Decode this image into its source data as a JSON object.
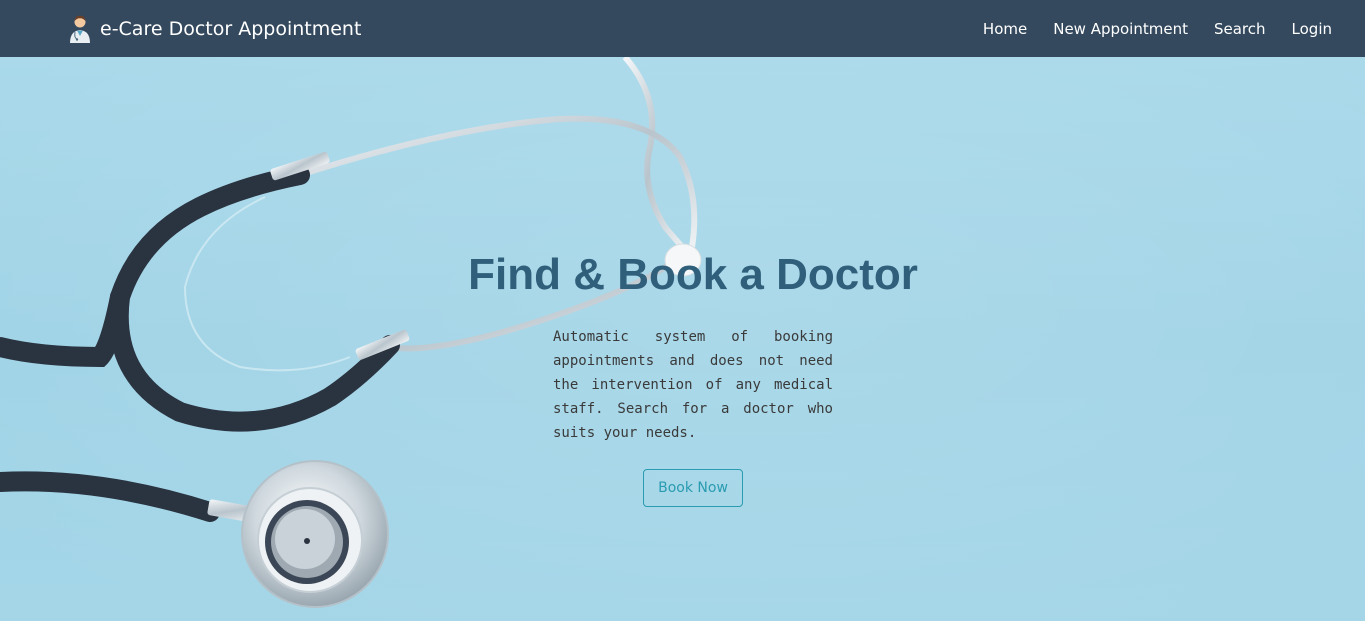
{
  "navbar": {
    "brand_title": "e-Care Doctor Appointment",
    "brand_icon": "doctor-avatar-icon",
    "links": [
      "Home",
      "New Appointment",
      "Search",
      "Login"
    ]
  },
  "hero": {
    "title": "Find & Book a Doctor",
    "description": "Automatic system of booking appointments and does not need the intervention of any medical staff. Search for a doctor who suits your needs.",
    "button_label": "Book Now",
    "background_image": "stethoscope-on-blue-background"
  },
  "colors": {
    "navbar_bg": "#34495e",
    "hero_bg": "#a4d6e8",
    "title": "#2f5f7a",
    "button": "#2a9bb0"
  }
}
